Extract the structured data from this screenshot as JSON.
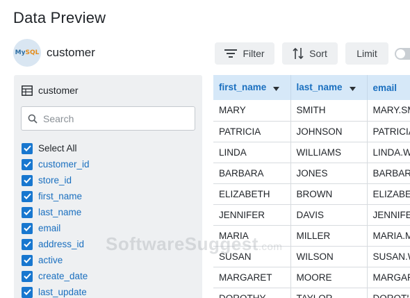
{
  "window": {
    "title": "Data Preview"
  },
  "source": {
    "logo_text_blue": "My",
    "logo_text_orange": "SQL",
    "table_name": "customer"
  },
  "toolbar": {
    "filter_label": "Filter",
    "sort_label": "Sort",
    "limit_label": "Limit",
    "limit_toggle_on": false
  },
  "sidebar": {
    "table_label": "customer",
    "search_placeholder": "Search",
    "select_all_label": "Select All",
    "columns": [
      {
        "label": "customer_id",
        "checked": true
      },
      {
        "label": "store_id",
        "checked": true
      },
      {
        "label": "first_name",
        "checked": true
      },
      {
        "label": "last_name",
        "checked": true
      },
      {
        "label": "email",
        "checked": true
      },
      {
        "label": "address_id",
        "checked": true
      },
      {
        "label": "active",
        "checked": true
      },
      {
        "label": "create_date",
        "checked": true
      },
      {
        "label": "last_update",
        "checked": true
      }
    ]
  },
  "grid": {
    "headers": [
      "first_name",
      "last_name",
      "email"
    ],
    "rows": [
      [
        "MARY",
        "SMITH",
        "MARY.SM"
      ],
      [
        "PATRICIA",
        "JOHNSON",
        "PATRICIA"
      ],
      [
        "LINDA",
        "WILLIAMS",
        "LINDA.W"
      ],
      [
        "BARBARA",
        "JONES",
        "BARBAR"
      ],
      [
        "ELIZABETH",
        "BROWN",
        "ELIZABE"
      ],
      [
        "JENNIFER",
        "DAVIS",
        "JENNIFE"
      ],
      [
        "MARIA",
        "MILLER",
        "MARIA.M"
      ],
      [
        "SUSAN",
        "WILSON",
        "SUSAN.W"
      ],
      [
        "MARGARET",
        "MOORE",
        "MARGAR"
      ],
      [
        "DOROTHY",
        "TAYLOR",
        "DOROTH"
      ]
    ]
  },
  "watermark": {
    "text": "SoftwareSuggest",
    "suffix": ".com"
  },
  "colors": {
    "accent": "#1877cf",
    "header_bg": "#d6e8f8",
    "panel_bg": "#eef0f2"
  }
}
